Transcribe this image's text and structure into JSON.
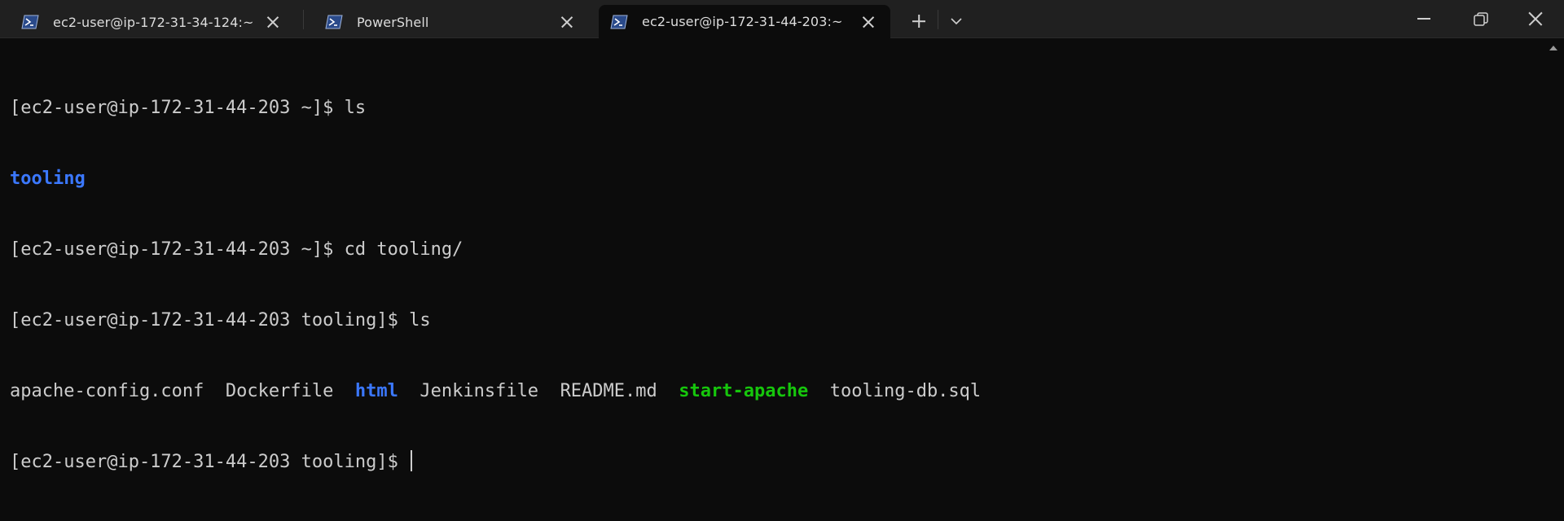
{
  "tabs": [
    {
      "title": "ec2-user@ip-172-31-34-124:~",
      "active": false,
      "icon": "powershell-icon"
    },
    {
      "title": "PowerShell",
      "active": false,
      "icon": "powershell-icon"
    },
    {
      "title": "ec2-user@ip-172-31-44-203:~",
      "active": true,
      "icon": "powershell-icon"
    }
  ],
  "terminal": {
    "l1_prompt": "[ec2-user@ip-172-31-44-203 ~]$ ",
    "l1_cmd": "ls",
    "l2_dir": "tooling",
    "l3_prompt": "[ec2-user@ip-172-31-44-203 ~]$ ",
    "l3_cmd": "cd tooling/",
    "l4_prompt": "[ec2-user@ip-172-31-44-203 tooling]$ ",
    "l4_cmd": "ls",
    "listing": [
      {
        "name": "apache-config.conf",
        "kind": "file"
      },
      {
        "name": "Dockerfile",
        "kind": "file"
      },
      {
        "name": "html",
        "kind": "dir"
      },
      {
        "name": "Jenkinsfile",
        "kind": "file"
      },
      {
        "name": "README.md",
        "kind": "file"
      },
      {
        "name": "start-apache",
        "kind": "exe"
      },
      {
        "name": "tooling-db.sql",
        "kind": "file"
      }
    ],
    "l6_prompt": "[ec2-user@ip-172-31-44-203 tooling]$ "
  },
  "colors": {
    "background": "#0c0c0c",
    "titlebar": "#202020",
    "text": "#cccccc",
    "directory": "#3b78ff",
    "executable": "#16c60c"
  }
}
